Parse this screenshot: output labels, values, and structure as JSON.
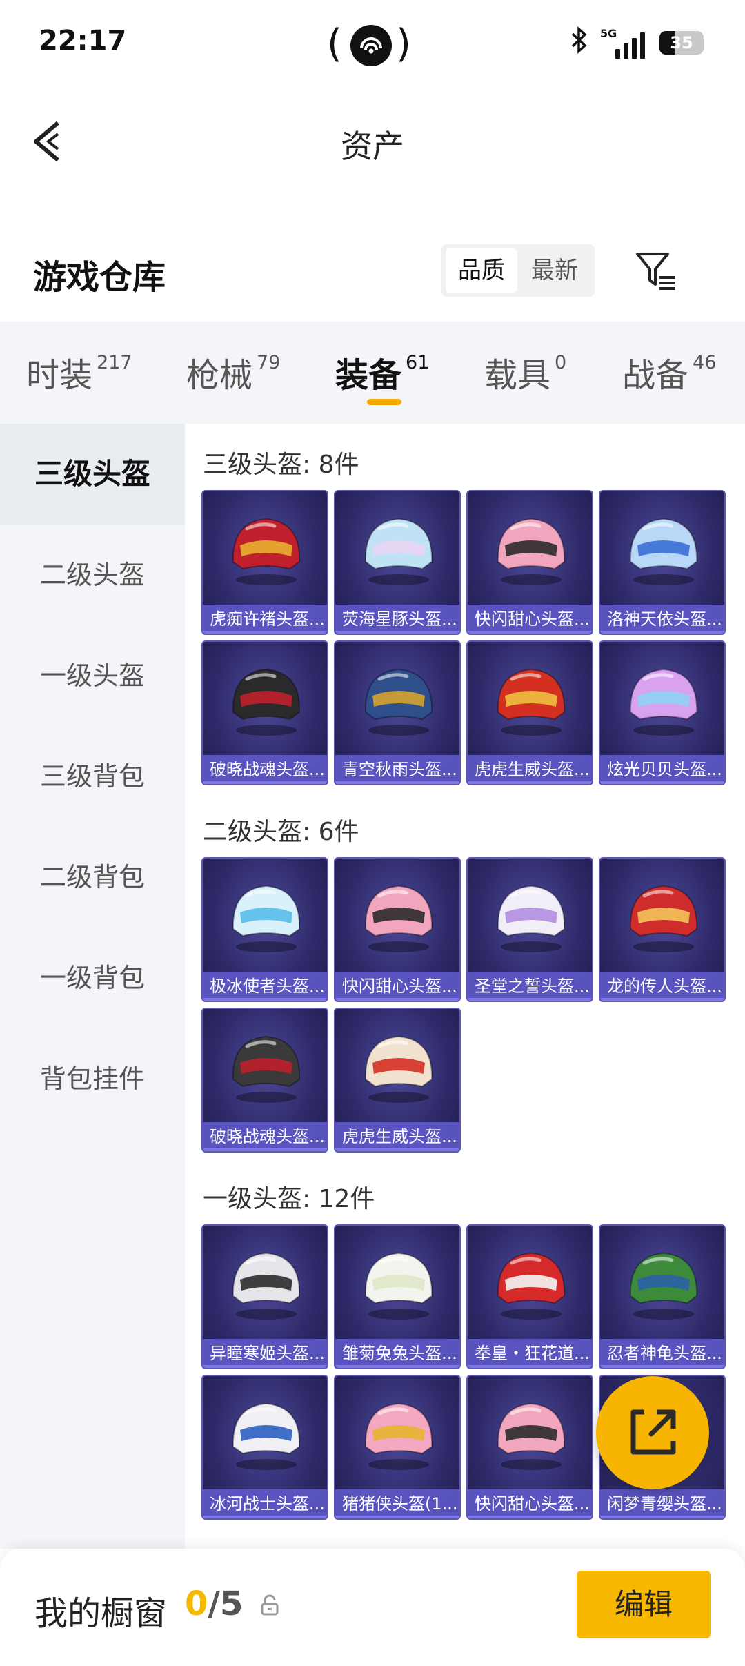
{
  "status_bar": {
    "time": "22:17",
    "network": "5G",
    "battery": "35"
  },
  "header": {
    "title": "资产"
  },
  "warehouse": {
    "title": "游戏仓库",
    "sort_options": [
      "品质",
      "最新"
    ],
    "sort_selected": "品质"
  },
  "tabs": [
    {
      "label": "时装",
      "count": "217"
    },
    {
      "label": "枪械",
      "count": "79"
    },
    {
      "label": "装备",
      "count": "61"
    },
    {
      "label": "载具",
      "count": "0"
    },
    {
      "label": "战备",
      "count": "46"
    }
  ],
  "sidebar": {
    "items": [
      "三级头盔",
      "二级头盔",
      "一级头盔",
      "三级背包",
      "二级背包",
      "一级背包",
      "背包挂件"
    ]
  },
  "sections": [
    {
      "title": "三级头盔: 8件",
      "items": [
        {
          "name": "虎痴许褚头盔...",
          "colors": [
            "#c0202c",
            "#e8b030"
          ]
        },
        {
          "name": "荧海星豚头盔...",
          "colors": [
            "#bfe3f5",
            "#e9d4f3"
          ]
        },
        {
          "name": "快闪甜心头盔...",
          "colors": [
            "#f2a6bd",
            "#2b2b2b"
          ]
        },
        {
          "name": "洛神天依头盔...",
          "colors": [
            "#b9d8f7",
            "#3a6fd6"
          ]
        },
        {
          "name": "破晓战魂头盔...",
          "colors": [
            "#2a2a2a",
            "#c0202c"
          ]
        },
        {
          "name": "青空秋雨头盔...",
          "colors": [
            "#2e4f8a",
            "#d5a32c"
          ]
        },
        {
          "name": "虎虎生威头盔...",
          "colors": [
            "#d33022",
            "#f0c040"
          ]
        },
        {
          "name": "炫光贝贝头盔...",
          "colors": [
            "#d9a2f0",
            "#8fd1f5"
          ]
        }
      ]
    },
    {
      "title": "二级头盔: 6件",
      "items": [
        {
          "name": "极冰使者头盔...",
          "colors": [
            "#d9f1fb",
            "#58bde8"
          ]
        },
        {
          "name": "快闪甜心头盔...",
          "colors": [
            "#f2a6bd",
            "#2b2b2b"
          ]
        },
        {
          "name": "圣堂之誓头盔...",
          "colors": [
            "#f1eef7",
            "#b28ee0"
          ]
        },
        {
          "name": "龙的传人头盔...",
          "colors": [
            "#cf2c2c",
            "#f2c45a"
          ]
        },
        {
          "name": "破晓战魂头盔...",
          "colors": [
            "#3a3a3a",
            "#c0202c"
          ]
        },
        {
          "name": "虎虎生威头盔...",
          "colors": [
            "#f1e2d0",
            "#d33022"
          ]
        }
      ]
    },
    {
      "title": "一级头盔: 12件",
      "items": [
        {
          "name": "异瞳寒姬头盔...",
          "colors": [
            "#e6e6ea",
            "#2c2c2c"
          ]
        },
        {
          "name": "雏菊兔兔头盔...",
          "colors": [
            "#f4f4ee",
            "#dfe8c8"
          ]
        },
        {
          "name": "拳皇・狂花道...",
          "colors": [
            "#d62a2a",
            "#f4f4f4"
          ]
        },
        {
          "name": "忍者神龟头盔...",
          "colors": [
            "#3d8a3a",
            "#2a5fa8"
          ]
        },
        {
          "name": "冰河战士头盔...",
          "colors": [
            "#f0f0f4",
            "#2b5fc2"
          ]
        },
        {
          "name": "猪猪侠头盔(1...",
          "colors": [
            "#f4a7c0",
            "#e7b530"
          ]
        },
        {
          "name": "快闪甜心头盔...",
          "colors": [
            "#f2a6bd",
            "#2b2b2b"
          ]
        },
        {
          "name": "闲梦青缨头盔...",
          "colors": [
            "#8fd0c8",
            "#f2e4c6"
          ]
        }
      ]
    }
  ],
  "showcase": {
    "label": "我的橱窗",
    "current": "0",
    "total": "/5"
  },
  "edit_button": "编辑",
  "colors": {
    "accent": "#f7b400",
    "card_bg": "#302c6c",
    "card_label": "#5c56c4"
  }
}
